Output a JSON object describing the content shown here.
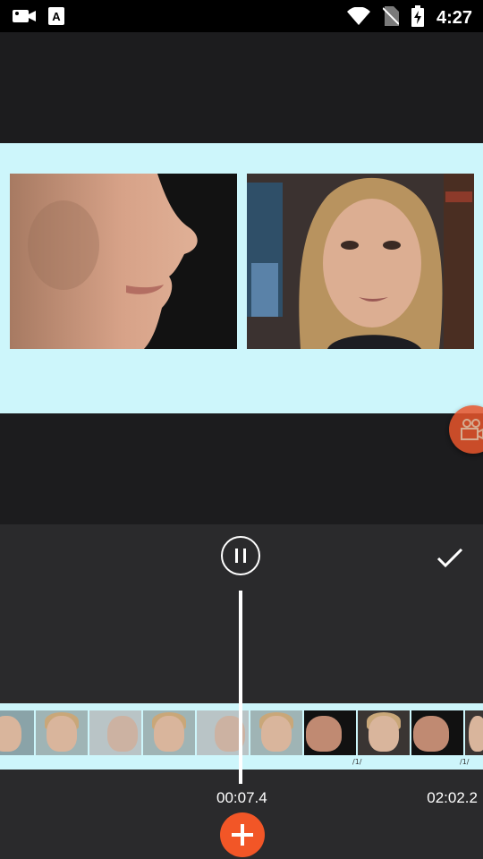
{
  "status_bar": {
    "time": "4:27",
    "icons": [
      "video-camera-icon",
      "font-a-icon",
      "wifi-icon",
      "no-sim-icon",
      "battery-charging-icon"
    ]
  },
  "preview": {
    "background_color": "#cdf6fb",
    "frames": [
      "face-closeup-profile",
      "woman-speaking-frontal"
    ]
  },
  "controls": {
    "play_state": "paused",
    "current_time": "00:07.4",
    "total_time": "02:02.2"
  },
  "timeline": {
    "tick_labels": [
      "/1/",
      "/1/"
    ]
  },
  "colors": {
    "accent": "#f25627",
    "panel": "#2a2a2c",
    "background": "#1c1c1e"
  }
}
